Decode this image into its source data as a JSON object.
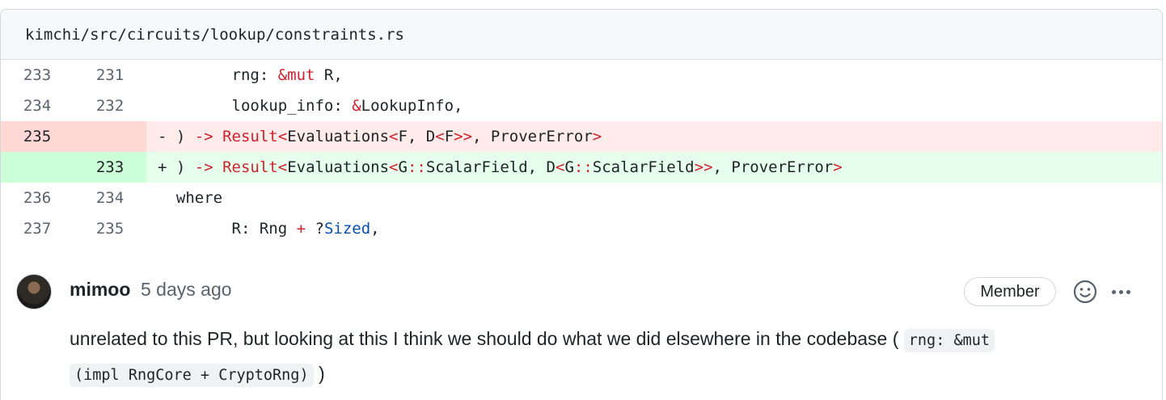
{
  "file": {
    "path": "kimchi/src/circuits/lookup/constraints.rs"
  },
  "diff": {
    "rows": [
      {
        "type": "ctx",
        "old": "233",
        "new": "231",
        "segments": [
          [
            "",
            "        rng: "
          ],
          [
            "k",
            "&mut"
          ],
          [
            "",
            " R,"
          ]
        ]
      },
      {
        "type": "ctx",
        "old": "234",
        "new": "232",
        "segments": [
          [
            "",
            "        lookup_info: "
          ],
          [
            "k",
            "&"
          ],
          [
            "",
            "LookupInfo,"
          ]
        ]
      },
      {
        "type": "del",
        "old": "235",
        "new": "",
        "segments": [
          [
            "",
            "- ) "
          ],
          [
            "k",
            "->"
          ],
          [
            "",
            " "
          ],
          [
            "k",
            "Result<"
          ],
          [
            "",
            "Evaluations"
          ],
          [
            "k",
            "<"
          ],
          [
            "",
            "F, D"
          ],
          [
            "k",
            "<"
          ],
          [
            "",
            "F"
          ],
          [
            "k",
            ">>"
          ],
          [
            "",
            ", ProverError"
          ],
          [
            "k",
            ">"
          ]
        ]
      },
      {
        "type": "add",
        "old": "",
        "new": "233",
        "segments": [
          [
            "",
            "+ ) "
          ],
          [
            "k",
            "->"
          ],
          [
            "",
            " "
          ],
          [
            "k",
            "Result<"
          ],
          [
            "",
            "Evaluations"
          ],
          [
            "k",
            "<"
          ],
          [
            "",
            "G"
          ],
          [
            "k",
            "::"
          ],
          [
            "",
            "ScalarField, D"
          ],
          [
            "k",
            "<"
          ],
          [
            "",
            "G"
          ],
          [
            "k",
            "::"
          ],
          [
            "",
            "ScalarField"
          ],
          [
            "k",
            ">>"
          ],
          [
            "",
            ", ProverError"
          ],
          [
            "k",
            ">"
          ]
        ]
      },
      {
        "type": "ctx",
        "old": "236",
        "new": "234",
        "segments": [
          [
            "",
            "  where"
          ]
        ]
      },
      {
        "type": "ctx",
        "old": "237",
        "new": "235",
        "segments": [
          [
            "",
            "        R: Rng "
          ],
          [
            "k",
            "+"
          ],
          [
            "",
            " ?"
          ],
          [
            "b",
            "Sized"
          ],
          [
            "",
            ","
          ]
        ]
      }
    ]
  },
  "comment": {
    "author": "mimoo",
    "time": "5 days ago",
    "badge": "Member",
    "text_before": "unrelated to this PR, but looking at this I think we should do what we did elsewhere in the codebase (",
    "code_line1": "rng: &mut",
    "code_line2": "(impl RngCore + CryptoRng)",
    "text_after": ")"
  },
  "icons": {
    "emoji": "smiley-icon",
    "more": "kebab-horizontal-icon"
  }
}
